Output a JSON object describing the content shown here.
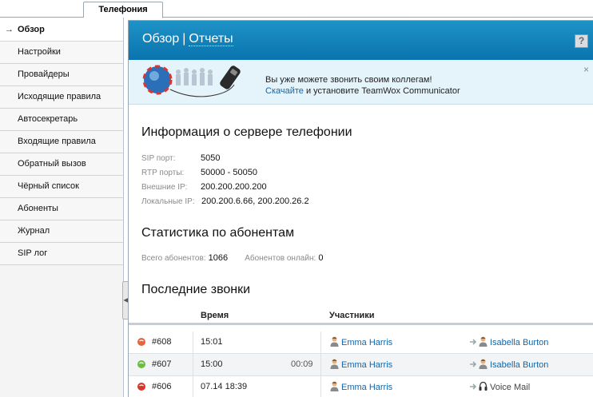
{
  "app": {
    "tab": "Телефония"
  },
  "sidebar": {
    "items": [
      {
        "label": "Обзор",
        "active": true
      },
      {
        "label": "Настройки"
      },
      {
        "label": "Провайдеры"
      },
      {
        "label": "Исходящие правила"
      },
      {
        "label": "Автосекретарь"
      },
      {
        "label": "Входящие правила"
      },
      {
        "label": "Обратный вызов"
      },
      {
        "label": "Чёрный список"
      },
      {
        "label": "Абоненты"
      },
      {
        "label": "Журнал"
      },
      {
        "label": "SIP лог"
      }
    ]
  },
  "header": {
    "overview": "Обзор",
    "separator": "|",
    "reports": "Отчеты",
    "help": "?"
  },
  "banner": {
    "line1": "Вы уже можете звонить своим коллегам!",
    "download_link": "Скачайте",
    "line2_rest": " и установите TeamWox Communicator",
    "close": "×"
  },
  "server": {
    "title": "Информация о сервере телефонии",
    "sip_label": "SIP порт:",
    "sip_value": "5050",
    "rtp_label": "RTP порты:",
    "rtp_value": "50000 - 50050",
    "ext_label": "Внешние IP:",
    "ext_value": "200.200.200.200",
    "local_label": "Локальные IP:",
    "local_value": "200.200.6.66, 200.200.26.2"
  },
  "stats": {
    "title": "Статистика по абонентам",
    "total_label": "Всего абонентов:",
    "total_value": "1066",
    "online_label": "Абонентов онлайн:",
    "online_value": "0"
  },
  "calls": {
    "title": "Последние звонки",
    "col_time": "Время",
    "col_participants": "Участники",
    "rows": [
      {
        "id": "#608",
        "time": "15:01",
        "duration": "",
        "from": "Emma Harris",
        "to": "Isabella Burton",
        "status_color": "#e8643a",
        "to_type": "person"
      },
      {
        "id": "#607",
        "time": "15:00",
        "duration": "00:09",
        "from": "Emma Harris",
        "to": "Isabella Burton",
        "status_color": "#6bbf3e",
        "to_type": "person"
      },
      {
        "id": "#606",
        "time": "07.14 18:39",
        "duration": "",
        "from": "Emma Harris",
        "to": "Voice Mail",
        "status_color": "#d9362b",
        "to_type": "voicemail"
      }
    ]
  }
}
